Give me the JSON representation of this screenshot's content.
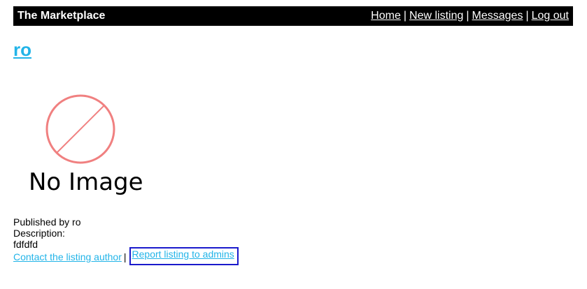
{
  "header": {
    "brand": "The Marketplace",
    "nav": [
      {
        "label": "Home"
      },
      {
        "label": "New listing"
      },
      {
        "label": "Messages"
      },
      {
        "label": "Log out"
      }
    ],
    "separator": "|"
  },
  "listing": {
    "title": "ro",
    "image_placeholder": "No Image",
    "published_by": "Published by ro",
    "description_label": "Description:",
    "description": "fdfdfd"
  },
  "actions": {
    "contact_label": "Contact the listing author",
    "separator": "|",
    "report_label": "Report listing to admins"
  },
  "colors": {
    "header_bg": "#000000",
    "link": "#22b4e8",
    "no_image_icon": "#f08080",
    "focus_outline": "#1a1acc"
  }
}
